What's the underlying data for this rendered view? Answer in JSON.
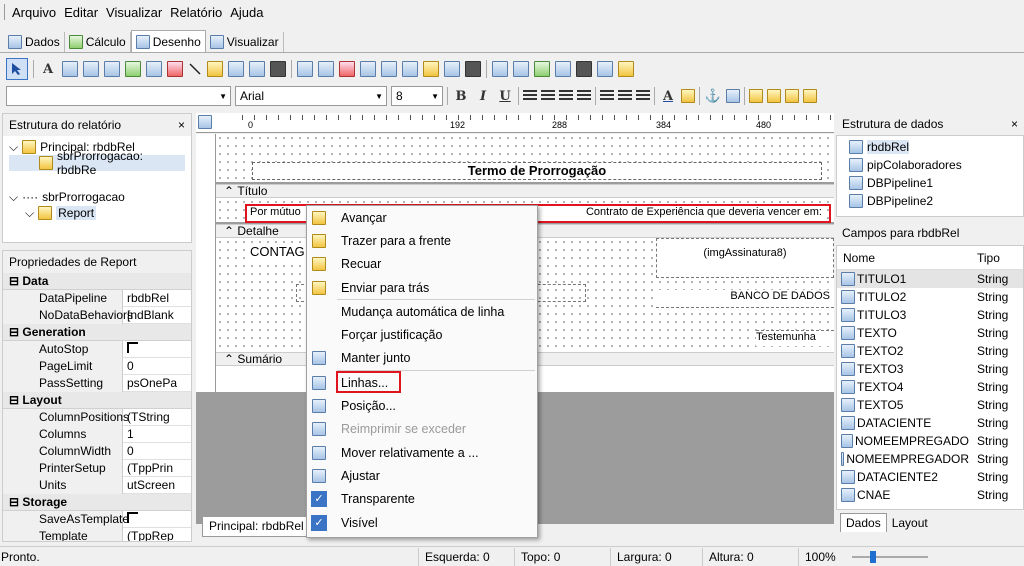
{
  "menu": [
    "Arquivo",
    "Editar",
    "Visualizar",
    "Relatório",
    "Ajuda"
  ],
  "tabs": [
    {
      "label": "Dados",
      "icon": "data-icon"
    },
    {
      "label": "Cálculo",
      "icon": "calc-icon"
    },
    {
      "label": "Desenho",
      "icon": "design-icon"
    },
    {
      "label": "Visualizar",
      "icon": "preview-icon"
    }
  ],
  "font": {
    "name": "Arial",
    "size": "8"
  },
  "format_buttons": {
    "bold": "B",
    "italic": "I",
    "underline": "U"
  },
  "structure": {
    "title": "Estrutura do relatório",
    "close": "×",
    "items": [
      "Principal: rbdbRel",
      "sbrProrrogacao: rbdbRe"
    ],
    "items2": [
      "sbrProrrogacao",
      "Report"
    ]
  },
  "properties": {
    "title": "Propriedades de Report",
    "groups": [
      {
        "name": "Data",
        "rows": [
          {
            "name": "DataPipeline",
            "value": "rbdbRel"
          },
          {
            "name": "NoDataBehaviors",
            "value": "[ndBlank"
          }
        ]
      },
      {
        "name": "Generation",
        "rows": [
          {
            "name": "AutoStop",
            "value": ""
          },
          {
            "name": "PageLimit",
            "value": "0"
          },
          {
            "name": "PassSetting",
            "value": "psOnePa"
          }
        ]
      },
      {
        "name": "Layout",
        "rows": [
          {
            "name": "ColumnPositions",
            "value": "(TString"
          },
          {
            "name": "Columns",
            "value": "1"
          },
          {
            "name": "ColumnWidth",
            "value": "0"
          },
          {
            "name": "PrinterSetup",
            "value": "(TppPrin"
          },
          {
            "name": "Units",
            "value": "utScreen"
          }
        ]
      },
      {
        "name": "Storage",
        "rows": [
          {
            "name": "SaveAsTemplate",
            "value": ""
          },
          {
            "name": "Template",
            "value": "(TppRep"
          }
        ]
      }
    ]
  },
  "ruler": {
    "marks": [
      "0",
      "192",
      "288",
      "384",
      "480"
    ]
  },
  "bands": {
    "title": "Título",
    "detail": "Detalhe",
    "summary": "Sumário"
  },
  "report": {
    "heading": "Termo de Prorrogação",
    "line_left": "Por mútuo",
    "line_right": "Contrato de Experiência que deveria vencer em:",
    "contag": "CONTAG",
    "img": "(imgAssinatura8)",
    "bank": "BANCO DE DADOS",
    "witness": "Testemunha"
  },
  "bottom_tab": "Principal: rbdbRel",
  "context_menu": [
    {
      "label": "Avançar",
      "icon": "bring-forward-icon"
    },
    {
      "label": "Trazer para a frente",
      "icon": "bring-to-front-icon"
    },
    {
      "label": "Recuar",
      "icon": "send-backward-icon"
    },
    {
      "label": "Enviar para trás",
      "icon": "send-to-back-icon"
    },
    {
      "label": "Mudança automática de linha",
      "icon": ""
    },
    {
      "label": "Forçar justificação",
      "icon": ""
    },
    {
      "label": "Manter junto",
      "icon": "keep-together-icon"
    },
    {
      "label": "Linhas...",
      "icon": "lines-icon"
    },
    {
      "label": "Posição...",
      "icon": "position-icon"
    },
    {
      "label": "Reimprimir se exceder",
      "icon": "reprint-icon",
      "disabled": true
    },
    {
      "label": "Mover relativamente a ...",
      "icon": "move-relative-icon"
    },
    {
      "label": "Ajustar",
      "icon": "stretch-icon"
    },
    {
      "label": "Transparente",
      "icon": "check-icon"
    },
    {
      "label": "Visível",
      "icon": "check-icon"
    }
  ],
  "data_tree": {
    "title": "Estrutura de dados",
    "close": "×",
    "items": [
      "rbdbRel",
      "pipColaboradores",
      "DBPipeline1",
      "DBPipeline2"
    ]
  },
  "fields": {
    "title": "Campos para rbdbRel",
    "col_name": "Nome",
    "col_type": "Tipo",
    "rows": [
      [
        "TITULO1",
        "String"
      ],
      [
        "TITULO2",
        "String"
      ],
      [
        "TITULO3",
        "String"
      ],
      [
        "TEXTO",
        "String"
      ],
      [
        "TEXTO2",
        "String"
      ],
      [
        "TEXTO3",
        "String"
      ],
      [
        "TEXTO4",
        "String"
      ],
      [
        "TEXTO5",
        "String"
      ],
      [
        "DATACIENTE",
        "String"
      ],
      [
        "NOMEEMPREGADO",
        "String"
      ],
      [
        "NOMEEMPREGADOR",
        "String"
      ],
      [
        "DATACIENTE2",
        "String"
      ],
      [
        "CNAE",
        "String"
      ]
    ]
  },
  "right_tabs": [
    "Dados",
    "Layout"
  ],
  "status": {
    "text": "Pronto.",
    "left": "Esquerda: 0",
    "top": "Topo: 0",
    "width": "Largura: 0",
    "height": "Altura: 0",
    "zoom": "100%"
  }
}
